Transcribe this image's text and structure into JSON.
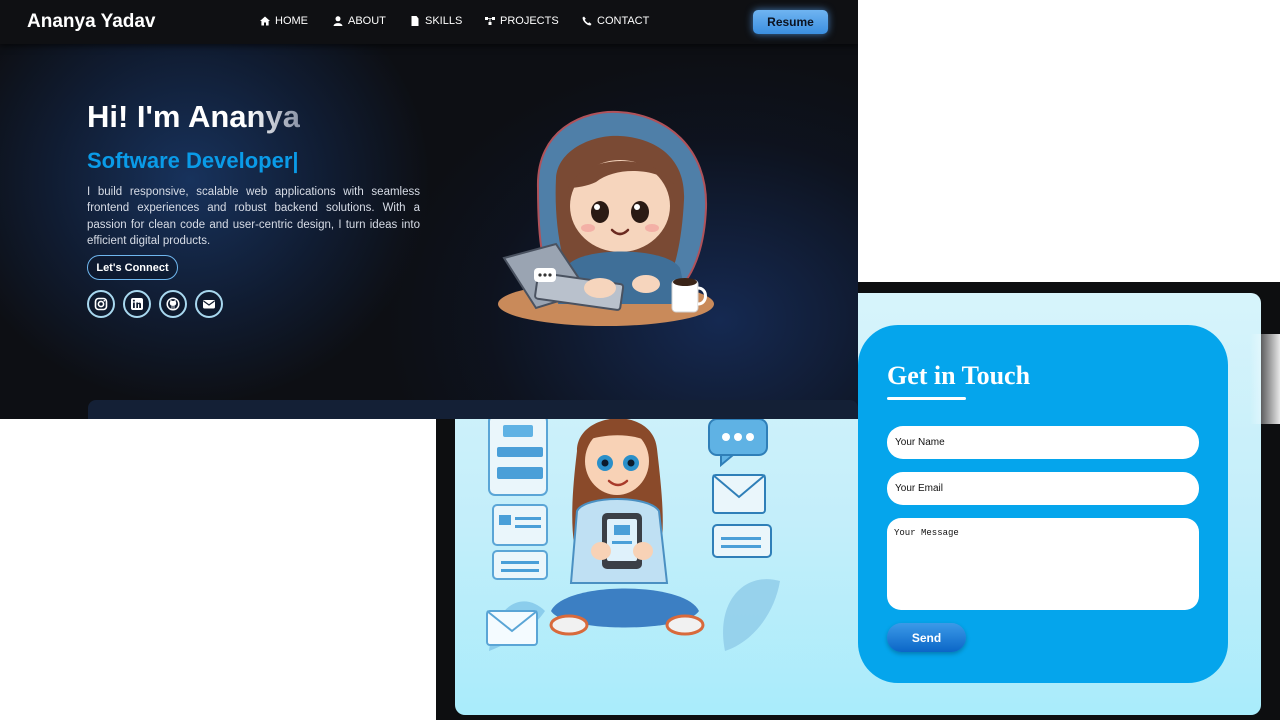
{
  "navbar": {
    "brand": "Ananya Yadav",
    "items": [
      {
        "label": "HOME",
        "icon": "home-icon"
      },
      {
        "label": "ABOUT",
        "icon": "user-icon"
      },
      {
        "label": "SKILLS",
        "icon": "document-icon"
      },
      {
        "label": "PROJECTS",
        "icon": "projects-icon"
      },
      {
        "label": "CONTACT",
        "icon": "phone-icon"
      }
    ],
    "resume_label": "Resume"
  },
  "hero": {
    "greeting_main": "Hi! I'm Ana",
    "greeting_faded": "nya",
    "role": "Software Developer|",
    "bio": "I build responsive, scalable web applications with seamless frontend experiences and robust backend solutions. With a passion for clean code and user-centric design, I turn ideas into efficient digital products.",
    "connect_label": "Let's Connect",
    "socials": [
      "instagram-icon",
      "linkedin-icon",
      "github-icon",
      "email-icon"
    ]
  },
  "contact": {
    "title": "Get in Touch",
    "name_placeholder": "Your Name",
    "email_placeholder": "Your Email",
    "message_placeholder": "Your Message",
    "send_label": "Send"
  },
  "colors": {
    "accent_blue": "#0a9be8",
    "form_card": "#05a5ec",
    "hero_background": "#0d0f14"
  }
}
